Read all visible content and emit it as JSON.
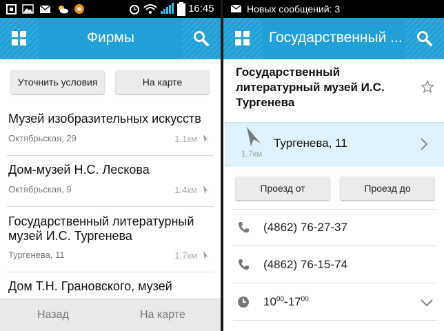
{
  "left": {
    "status": {
      "time": "16:45"
    },
    "appbar": {
      "title": "Фирмы",
      "menu_icon": "grid-icon",
      "search_icon": "search-icon"
    },
    "filters": {
      "refine_label": "Уточнить условия",
      "map_label": "На карте"
    },
    "items": [
      {
        "title": "Музей изобразительных искусств",
        "address": "Октябрьская, 29",
        "distance": "1.1км"
      },
      {
        "title": "Дом-музей Н.С. Лескова",
        "address": "Октябрьская, 9",
        "distance": "1.4км"
      },
      {
        "title": "Государственный литературный музей И.С. Тургенева",
        "address": "Тургенева, 11",
        "distance": "1.7км"
      },
      {
        "title": "Дом Т.Н. Грановского, музей"
      }
    ],
    "bottom": {
      "back_label": "Назад",
      "map_label": "На карте"
    }
  },
  "right": {
    "status": {
      "notification": "Новых сообщений: 3"
    },
    "appbar": {
      "title": "Государственный ...",
      "menu_icon": "grid-icon",
      "search_icon": "search-icon"
    },
    "place": {
      "name": "Государственный литературный музей И.С. Тургенева"
    },
    "address": {
      "street": "Тургенева, 11",
      "distance": "1.7км"
    },
    "route": {
      "from_label": "Проезд от",
      "to_label": "Проезд до"
    },
    "phones": [
      "(4862) 76-27-37",
      "(4862) 76-15-74"
    ],
    "hours": {
      "open": "10",
      "open_min": "00",
      "separator": "-",
      "close": "17",
      "close_min": "00"
    }
  },
  "colors": {
    "accent": "#1fa0d6",
    "highlight_row": "#dff1fb"
  }
}
